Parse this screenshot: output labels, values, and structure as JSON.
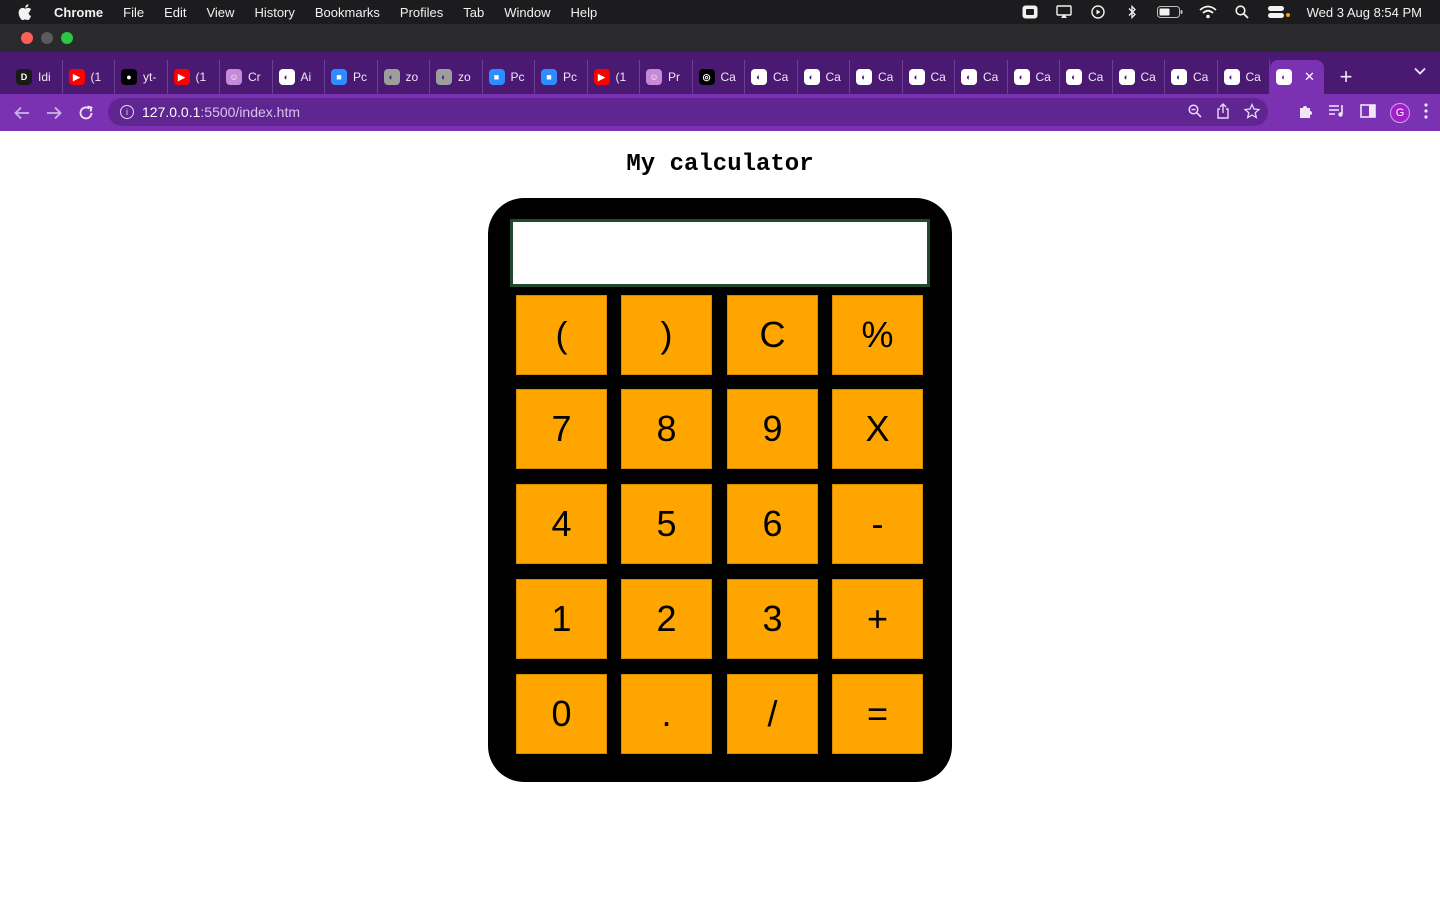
{
  "menubar": {
    "app_name": "Chrome",
    "items": [
      "File",
      "Edit",
      "View",
      "History",
      "Bookmarks",
      "Profiles",
      "Tab",
      "Window",
      "Help"
    ],
    "clock": "Wed 3 Aug  8:54 PM"
  },
  "tabs": [
    {
      "label": "Idi",
      "icon": "site-favicon",
      "color": "#1a1a1a"
    },
    {
      "label": "(1",
      "icon": "youtube-icon",
      "color": "#ff0000"
    },
    {
      "label": "yt-",
      "icon": "github-icon",
      "color": "#000000"
    },
    {
      "label": "(1",
      "icon": "youtube-icon",
      "color": "#ff0000"
    },
    {
      "label": "Cr",
      "icon": "profile-favicon",
      "color": "#c58ad8"
    },
    {
      "label": "Ai",
      "icon": "globe-icon",
      "color": "#ffffff"
    },
    {
      "label": "Pc",
      "icon": "zoom-icon",
      "color": "#2d8cff"
    },
    {
      "label": "zo",
      "icon": "globe-icon",
      "color": "#9e9e9e"
    },
    {
      "label": "zo",
      "icon": "globe-icon",
      "color": "#9e9e9e"
    },
    {
      "label": "Pc",
      "icon": "zoom-icon",
      "color": "#2d8cff"
    },
    {
      "label": "Pc",
      "icon": "zoom-icon",
      "color": "#2d8cff"
    },
    {
      "label": "(1",
      "icon": "youtube-icon",
      "color": "#ff0000"
    },
    {
      "label": "Pr",
      "icon": "profile-favicon",
      "color": "#c58ad8"
    },
    {
      "label": "Ca",
      "icon": "openai-icon",
      "color": "#000000"
    },
    {
      "label": "Ca",
      "icon": "globe-icon",
      "color": "#ffffff"
    },
    {
      "label": "Ca",
      "icon": "globe-icon",
      "color": "#ffffff"
    },
    {
      "label": "Ca",
      "icon": "globe-icon",
      "color": "#ffffff"
    },
    {
      "label": "Ca",
      "icon": "globe-icon",
      "color": "#ffffff"
    },
    {
      "label": "Ca",
      "icon": "globe-icon",
      "color": "#ffffff"
    },
    {
      "label": "Ca",
      "icon": "globe-icon",
      "color": "#ffffff"
    },
    {
      "label": "Ca",
      "icon": "globe-icon",
      "color": "#ffffff"
    },
    {
      "label": "Ca",
      "icon": "globe-icon",
      "color": "#ffffff"
    },
    {
      "label": "Ca",
      "icon": "globe-icon",
      "color": "#ffffff"
    },
    {
      "label": "Ca",
      "icon": "globe-icon",
      "color": "#ffffff"
    }
  ],
  "active_tab": {
    "icon": "globe-icon",
    "close_label": "✕"
  },
  "new_tab_label": "+",
  "address_bar": {
    "host": "127.0.0.1",
    "path": ":5500/index.htm"
  },
  "page": {
    "title": "My calculator",
    "display_value": ""
  },
  "buttons": [
    [
      "(",
      ")",
      "C",
      "%"
    ],
    [
      "7",
      "8",
      "9",
      "X"
    ],
    [
      "4",
      "5",
      "6",
      "-"
    ],
    [
      "1",
      "2",
      "3",
      "+"
    ],
    [
      "0",
      ".",
      "/",
      "="
    ]
  ],
  "colors": {
    "calculator_body": "#000000",
    "button": "#ffa500",
    "display_border": "#1f4a2e",
    "browser_frame": "#7a32b3"
  }
}
